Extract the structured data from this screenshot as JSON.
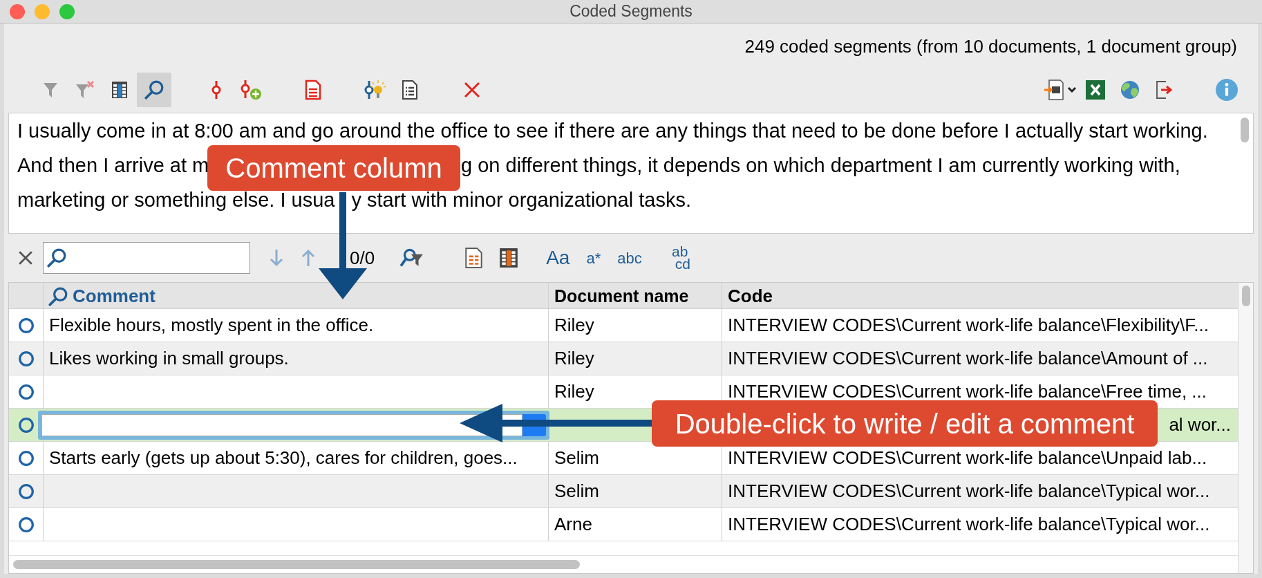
{
  "window": {
    "title": "Coded Segments"
  },
  "summary": "249 coded segments (from 10 documents, 1 document group)",
  "toolbar": {
    "left": [
      {
        "kind": "funnel",
        "selected": false
      },
      {
        "kind": "funnel-x",
        "selected": false
      },
      {
        "kind": "grid",
        "selected": false
      },
      {
        "kind": "search",
        "selected": true
      },
      {
        "kind": "gap"
      },
      {
        "kind": "pin",
        "selected": false
      },
      {
        "kind": "pin-add",
        "selected": false
      },
      {
        "kind": "gap"
      },
      {
        "kind": "doc-red",
        "selected": false
      },
      {
        "kind": "gap"
      },
      {
        "kind": "pin-bulb",
        "selected": false
      },
      {
        "kind": "doc-list",
        "selected": false
      },
      {
        "kind": "gap"
      },
      {
        "kind": "delete",
        "selected": false
      }
    ],
    "right": [
      {
        "kind": "import",
        "selected": false
      },
      {
        "kind": "excel",
        "selected": false
      },
      {
        "kind": "globe",
        "selected": false
      },
      {
        "kind": "export",
        "selected": false
      },
      {
        "kind": "gap"
      },
      {
        "kind": "info",
        "selected": false
      }
    ]
  },
  "preview": {
    "lines": [
      [
        "I usually come in at 8:00 am and go around the office to see if there are any things that need to be done before I actually start working."
      ],
      [
        "And then I arrive at m",
        "g on different things, it depends on which department I am currently working with,"
      ],
      [
        "marketing or something else. I usua",
        "y start with minor organizational tasks."
      ]
    ]
  },
  "search_bar": {
    "counter": "0/0",
    "options": [
      "Aa",
      "a*",
      "abc"
    ],
    "replace": [
      "ab",
      "cd"
    ]
  },
  "table": {
    "columns": [
      "Comment",
      "Document name",
      "Code"
    ],
    "rows": [
      {
        "kind": "text",
        "selected": false,
        "comment": "Flexible hours, mostly spent in the office.",
        "document": "Riley",
        "code": "INTERVIEW CODES\\Current work-life balance\\Flexibility\\F..."
      },
      {
        "kind": "text",
        "selected": false,
        "comment": "Likes working in small groups.",
        "document": "Riley",
        "code": "INTERVIEW CODES\\Current work-life balance\\Amount of ..."
      },
      {
        "kind": "text",
        "selected": false,
        "document": "Riley",
        "code": "INTERVIEW CODES\\Current work-life balance\\Free time, ..."
      },
      {
        "kind": "editing",
        "selected": true,
        "code": "al wor..."
      },
      {
        "kind": "text",
        "selected": false,
        "comment": "Starts early (gets up about 5:30), cares for children, goes...",
        "document": "Selim",
        "code": "INTERVIEW CODES\\Current work-life balance\\Unpaid lab..."
      },
      {
        "kind": "text",
        "selected": false,
        "document": "Selim",
        "code": "INTERVIEW CODES\\Current work-life balance\\Typical wor..."
      },
      {
        "kind": "text",
        "selected": false,
        "document": "Arne",
        "code": "INTERVIEW CODES\\Current work-life balance\\Typical wor..."
      }
    ]
  },
  "callouts": [
    {
      "text": "Comment column"
    },
    {
      "text": "Double-click to write / edit a comment"
    }
  ]
}
